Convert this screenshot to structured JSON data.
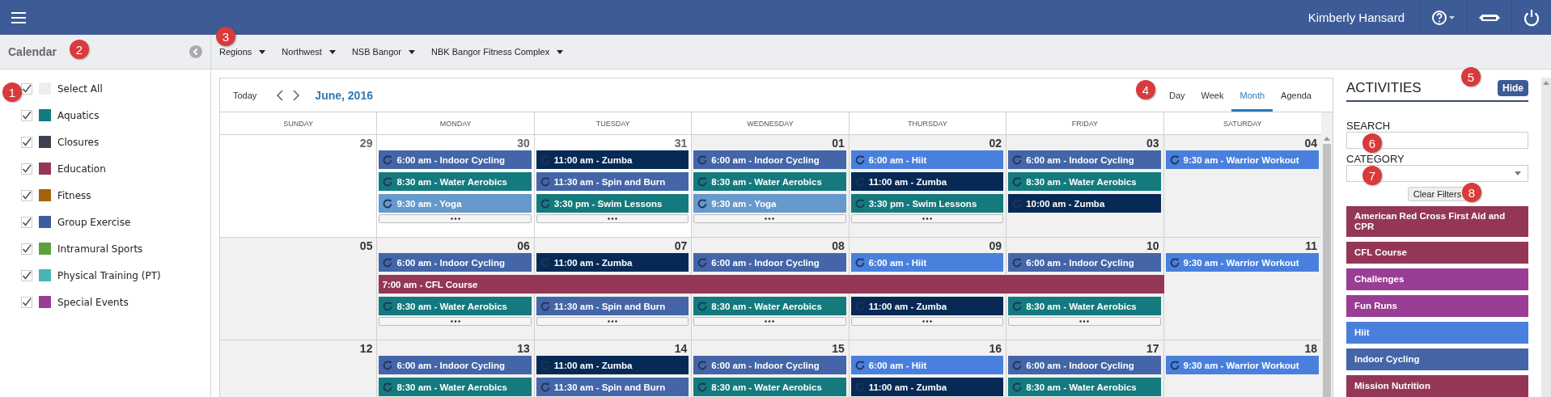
{
  "top_bar": {
    "user_name": "Kimberly Hansard"
  },
  "sidebar": {
    "title": "Calendar",
    "categories": [
      {
        "label": "Select All",
        "checked": true,
        "color": "#eeeeee"
      },
      {
        "label": "Aquatics",
        "checked": true,
        "color": "#137a80"
      },
      {
        "label": "Closures",
        "checked": true,
        "color": "#3c4250"
      },
      {
        "label": "Education",
        "checked": true,
        "color": "#943757"
      },
      {
        "label": "Fitness",
        "checked": true,
        "color": "#a0650c"
      },
      {
        "label": "Group Exercise",
        "checked": true,
        "color": "#3d5d9e"
      },
      {
        "label": "Intramural Sports",
        "checked": true,
        "color": "#5f9f3c"
      },
      {
        "label": "Physical Training (PT)",
        "checked": true,
        "color": "#4bb3b3"
      },
      {
        "label": "Special Events",
        "checked": true,
        "color": "#993d95"
      }
    ]
  },
  "breadcrumbs": [
    "Regions",
    "Northwest",
    "NSB Bangor",
    "NBK Bangor Fitness Complex"
  ],
  "calendar": {
    "today_label": "Today",
    "period": "June, 2016",
    "views": [
      {
        "label": "Day",
        "selected": false
      },
      {
        "label": "Week",
        "selected": false
      },
      {
        "label": "Month",
        "selected": true
      },
      {
        "label": "Agenda",
        "selected": false
      }
    ],
    "weekdays": [
      "SUNDAY",
      "MONDAY",
      "TUESDAY",
      "WEDNESDAY",
      "THURSDAY",
      "FRIDAY",
      "SATURDAY"
    ],
    "weeks": [
      {
        "days": [
          {
            "date": "29",
            "other_month": true,
            "more": false
          },
          {
            "date": "30",
            "other_month": true,
            "more": true,
            "events": [
              {
                "kind": "recurring",
                "label": "6:00 am - Indoor Cycling",
                "color": "#4466a8"
              },
              {
                "kind": "recurring",
                "label": "8:30 am - Water Aerobics",
                "color": "#147a7e"
              },
              {
                "kind": "recurring",
                "label": "9:30 am - Yoga",
                "color": "#6699cc"
              }
            ]
          },
          {
            "date": "31",
            "other_month": true,
            "more": true,
            "events": [
              {
                "kind": "recurring",
                "label": "11:00 am - Zumba",
                "color": "#062a55"
              },
              {
                "kind": "recurring",
                "label": "11:30 am - Spin and Burn",
                "color": "#4466a8"
              },
              {
                "kind": "recurring",
                "label": "3:30 pm - Swim Lessons",
                "color": "#147a7e"
              }
            ]
          },
          {
            "date": "01",
            "other_month": false,
            "more": true,
            "events": [
              {
                "kind": "recurring",
                "label": "6:00 am - Indoor Cycling",
                "color": "#4466a8"
              },
              {
                "kind": "recurring",
                "label": "8:30 am - Water Aerobics",
                "color": "#147a7e"
              },
              {
                "kind": "recurring",
                "label": "9:30 am - Yoga",
                "color": "#6699cc"
              }
            ]
          },
          {
            "date": "02",
            "other_month": false,
            "more": true,
            "events": [
              {
                "kind": "recurring",
                "label": "6:00 am - Hiit",
                "color": "#4a80dd"
              },
              {
                "kind": "recurring",
                "label": "11:00 am - Zumba",
                "color": "#062a55"
              },
              {
                "kind": "recurring",
                "label": "3:30 pm - Swim Lessons",
                "color": "#147a7e"
              }
            ]
          },
          {
            "date": "03",
            "other_month": false,
            "more": false,
            "events": [
              {
                "kind": "recurring",
                "label": "6:00 am - Indoor Cycling",
                "color": "#4466a8"
              },
              {
                "kind": "recurring",
                "label": "8:30 am - Water Aerobics",
                "color": "#147a7e"
              },
              {
                "kind": "recurring",
                "label": "10:00 am - Zumba",
                "color": "#062a55"
              }
            ]
          },
          {
            "date": "04",
            "other_month": false,
            "more": false,
            "events": [
              {
                "kind": "recurring",
                "label": "9:30 am - Warrior Workout",
                "color": "#4a80dd"
              }
            ]
          }
        ]
      },
      {
        "days": [
          {
            "date": "05",
            "other_month": false,
            "more": false
          },
          {
            "date": "06",
            "other_month": false,
            "more": true,
            "events": [
              {
                "kind": "recurring",
                "label": "6:00 am - Indoor Cycling",
                "color": "#4466a8"
              },
              {
                "kind": "span-start",
                "label": "7:00 am - CFL Course",
                "color": "#943757"
              },
              {
                "kind": "recurring",
                "label": "8:30 am - Water Aerobics",
                "color": "#147a7e"
              }
            ]
          },
          {
            "date": "07",
            "other_month": false,
            "more": true,
            "events": [
              {
                "kind": "recurring",
                "label": "11:00 am - Zumba",
                "color": "#062a55"
              },
              {
                "kind": "span-continue",
                "color": "#943757"
              },
              {
                "kind": "recurring",
                "label": "11:30 am - Spin and Burn",
                "color": "#4466a8"
              }
            ]
          },
          {
            "date": "08",
            "other_month": false,
            "more": true,
            "events": [
              {
                "kind": "recurring",
                "label": "6:00 am - Indoor Cycling",
                "color": "#4466a8"
              },
              {
                "kind": "span-continue",
                "color": "#943757"
              },
              {
                "kind": "recurring",
                "label": "8:30 am - Water Aerobics",
                "color": "#147a7e"
              }
            ]
          },
          {
            "date": "09",
            "other_month": false,
            "more": true,
            "events": [
              {
                "kind": "recurring",
                "label": "6:00 am - Hiit",
                "color": "#4a80dd"
              },
              {
                "kind": "span-continue",
                "color": "#943757"
              },
              {
                "kind": "recurring",
                "label": "11:00 am - Zumba",
                "color": "#062a55"
              }
            ]
          },
          {
            "date": "10",
            "other_month": false,
            "more": true,
            "events": [
              {
                "kind": "recurring",
                "label": "6:00 am - Indoor Cycling",
                "color": "#4466a8"
              },
              {
                "kind": "span-continue",
                "color": "#943757"
              },
              {
                "kind": "recurring",
                "label": "8:30 am - Water Aerobics",
                "color": "#147a7e"
              }
            ]
          },
          {
            "date": "11",
            "other_month": false,
            "more": false,
            "events": [
              {
                "kind": "recurring",
                "label": "9:30 am - Warrior Workout",
                "color": "#4a80dd"
              }
            ]
          }
        ]
      },
      {
        "days": [
          {
            "date": "12",
            "other_month": false
          },
          {
            "date": "13",
            "other_month": false,
            "events": [
              {
                "kind": "recurring",
                "label": "6:00 am - Indoor Cycling",
                "color": "#4466a8"
              },
              {
                "kind": "recurring",
                "label": "8:30 am - Water Aerobics",
                "color": "#147a7e"
              }
            ]
          },
          {
            "date": "14",
            "other_month": false,
            "events": [
              {
                "kind": "recurring",
                "label": "11:00 am - Zumba",
                "color": "#062a55"
              },
              {
                "kind": "recurring",
                "label": "11:30 am - Spin and Burn",
                "color": "#4466a8"
              }
            ]
          },
          {
            "date": "15",
            "other_month": false,
            "events": [
              {
                "kind": "recurring",
                "label": "6:00 am - Indoor Cycling",
                "color": "#4466a8"
              },
              {
                "kind": "recurring",
                "label": "8:30 am - Water Aerobics",
                "color": "#147a7e"
              }
            ]
          },
          {
            "date": "16",
            "other_month": false,
            "events": [
              {
                "kind": "recurring",
                "label": "6:00 am - Hiit",
                "color": "#4a80dd"
              },
              {
                "kind": "recurring",
                "label": "11:00 am - Zumba",
                "color": "#062a55"
              }
            ]
          },
          {
            "date": "17",
            "other_month": false,
            "events": [
              {
                "kind": "recurring",
                "label": "6:00 am - Indoor Cycling",
                "color": "#4466a8"
              },
              {
                "kind": "recurring",
                "label": "8:30 am - Water Aerobics",
                "color": "#147a7e"
              }
            ]
          },
          {
            "date": "18",
            "other_month": false,
            "events": [
              {
                "kind": "recurring",
                "label": "9:30 am - Warrior Workout",
                "color": "#4a80dd"
              }
            ]
          }
        ]
      }
    ]
  },
  "activities": {
    "title": "ACTIVITIES",
    "hide_label": "Hide",
    "search_label": "SEARCH",
    "category_label": "CATEGORY",
    "clear_label": "Clear Filters",
    "items": [
      {
        "label": "American Red Cross First Aid and CPR",
        "color": "#943757"
      },
      {
        "label": "CFL Course",
        "color": "#943757"
      },
      {
        "label": "Challenges",
        "color": "#993d95"
      },
      {
        "label": "Fun Runs",
        "color": "#993d95"
      },
      {
        "label": "Hiit",
        "color": "#4a80dd"
      },
      {
        "label": "Indoor Cycling",
        "color": "#4466a8"
      },
      {
        "label": "Mission Nutrition",
        "color": "#943757"
      }
    ]
  },
  "callouts": [
    "1",
    "2",
    "3",
    "4",
    "5",
    "6",
    "7",
    "8"
  ]
}
